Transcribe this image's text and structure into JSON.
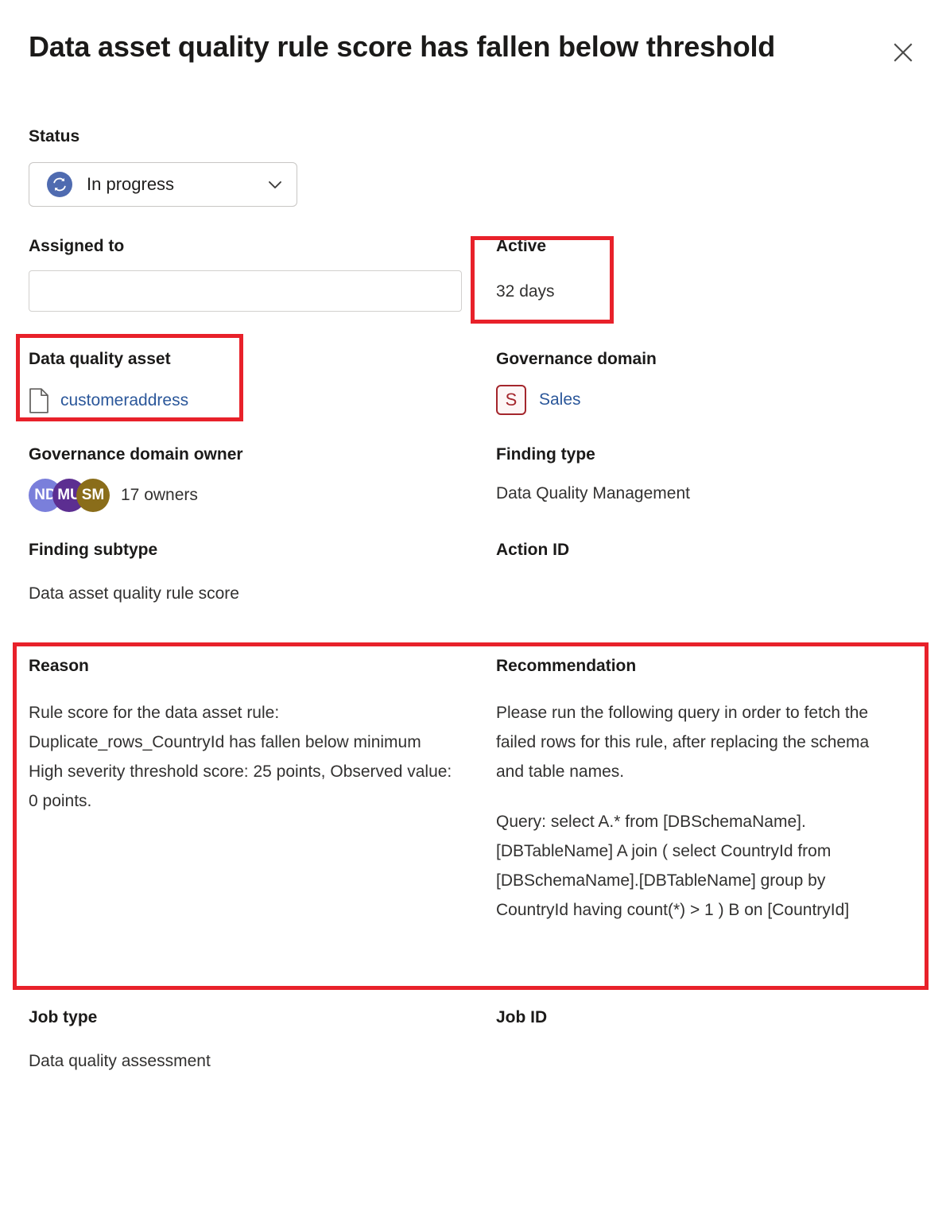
{
  "header": {
    "title": "Data asset quality rule score has fallen below threshold",
    "close_label": "Close",
    "close_icon": "close-icon"
  },
  "fields": {
    "status": {
      "label": "Status",
      "value": "In progress",
      "icon": "sync-icon",
      "icon_color": "#4f6bb0",
      "chevron_icon": "chevron-down-icon"
    },
    "assigned_to": {
      "label": "Assigned to",
      "value": "",
      "placeholder": ""
    },
    "active": {
      "label": "Active",
      "value": "32 days"
    },
    "data_quality_asset": {
      "label": "Data quality asset",
      "value": "customeraddress",
      "icon": "document-icon"
    },
    "governance_domain": {
      "label": "Governance domain",
      "value": "Sales",
      "badge_initial": "S",
      "badge_color": "#a4262c"
    },
    "governance_domain_owner": {
      "label": "Governance domain owner",
      "value": "17 owners",
      "avatars": [
        {
          "initials": "ND",
          "color": "#7a7fdb"
        },
        {
          "initials": "MU",
          "color": "#5c2e91"
        },
        {
          "initials": "SM",
          "color": "#8a6d1a"
        }
      ]
    },
    "finding_type": {
      "label": "Finding type",
      "value": "Data Quality Management"
    },
    "finding_subtype": {
      "label": "Finding subtype",
      "value": "Data asset quality rule score"
    },
    "action_id": {
      "label": "Action ID",
      "value": ""
    },
    "reason": {
      "label": "Reason",
      "value": "Rule score for the data asset rule: Duplicate_rows_CountryId has fallen below minimum High severity threshold score: 25 points, Observed value: 0 points."
    },
    "recommendation": {
      "label": "Recommendation",
      "paragraph1": "Please run the following query in order to fetch the failed rows for this rule, after replacing the schema and table names.",
      "paragraph2": "Query: select A.* from [DBSchemaName].[DBTableName] A join ( select CountryId from [DBSchemaName].[DBTableName] group by CountryId having count(*) > 1 ) B on [CountryId]"
    },
    "job_type": {
      "label": "Job type",
      "value": "Data quality assessment"
    },
    "job_id": {
      "label": "Job ID",
      "value": ""
    }
  },
  "annotations": {
    "highlight_color": "#e8212a",
    "boxes": [
      {
        "name": "active-highlight"
      },
      {
        "name": "data-quality-asset-highlight"
      },
      {
        "name": "reason-recommendation-highlight"
      }
    ]
  }
}
